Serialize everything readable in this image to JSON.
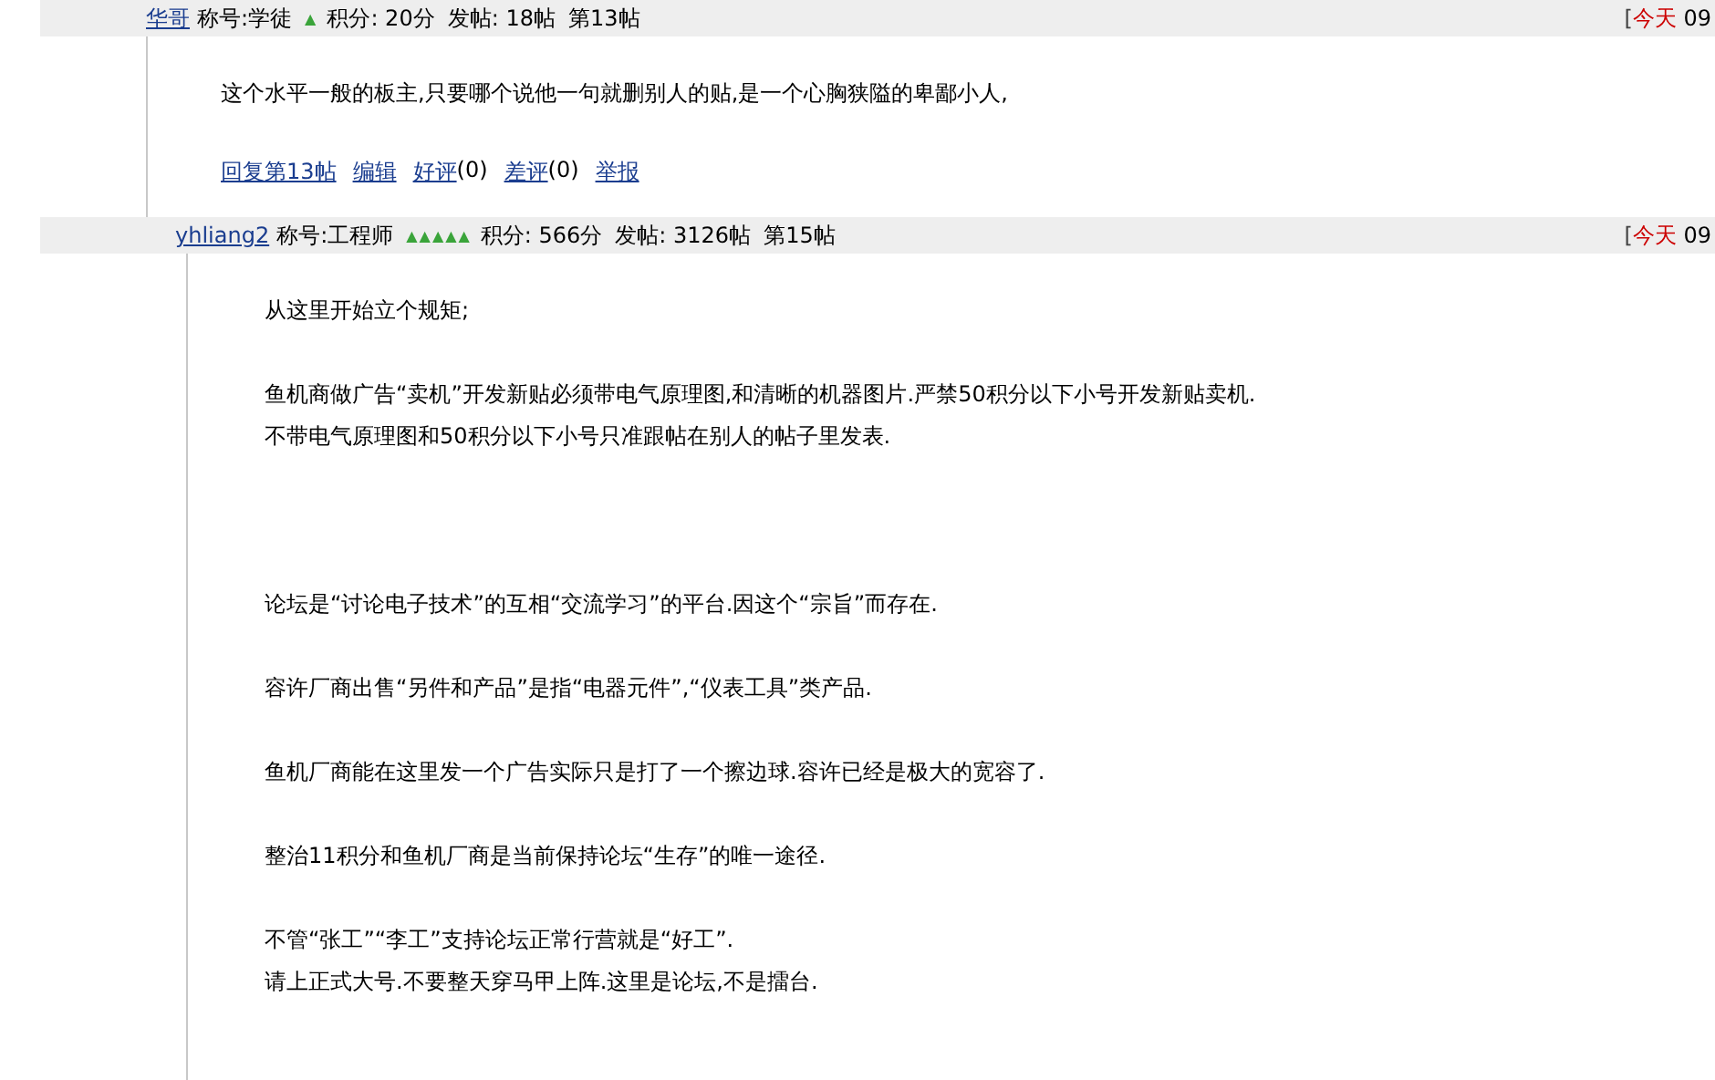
{
  "posts": [
    {
      "author": "华哥",
      "title": "称号:学徒",
      "rank": "▲",
      "score": "积分: 20分",
      "post_count": "发帖: 18帖",
      "floor": "第13帖",
      "bracket": "[",
      "day": "今天",
      "time": "09",
      "paragraphs": [
        [
          "这个水平一般的板主,只要哪个说他一句就删别人的贴,是一个心胸狭隘的卑鄙小人,"
        ]
      ],
      "actions": [
        {
          "kind": "link",
          "label": "回复第13帖"
        },
        {
          "kind": "link",
          "label": "编辑"
        },
        {
          "kind": "rating",
          "label": "好评",
          "count": "(0)"
        },
        {
          "kind": "rating",
          "label": "差评",
          "count": "(0)"
        },
        {
          "kind": "link",
          "label": "举报"
        }
      ]
    },
    {
      "author": "yhliang2",
      "title": "称号:工程师",
      "rank": "▲▲▲▲▲",
      "score": "积分: 566分",
      "post_count": "发帖: 3126帖",
      "floor": "第15帖",
      "bracket": "[",
      "day": "今天",
      "time": "09",
      "paragraphs": [
        [
          "从这里开始立个规矩;"
        ],
        [
          "鱼机商做广告“卖机”开发新贴必须带电气原理图,和清晰的机器图片.严禁50积分以下小号开发新贴卖机.",
          "不带电气原理图和50积分以下小号只准跟帖在别人的帖子里发表."
        ],
        [
          "论坛是“讨论电子技术”的互相“交流学习”的平台.因这个“宗旨”而存在."
        ],
        [
          "容许厂商出售“另件和产品”是指“电器元件”,“仪表工具”类产品."
        ],
        [
          "鱼机厂商能在这里发一个广告实际只是打了一个擦边球.容许已经是极大的宽容了."
        ],
        [
          "整治11积分和鱼机厂商是当前保持论坛“生存”的唯一途径."
        ],
        [
          "不管“张工”“李工”支持论坛正常行营就是“好工”.",
          "请上正式大号.不要整天穿马甲上阵.这里是论坛,不是擂台."
        ]
      ]
    }
  ]
}
